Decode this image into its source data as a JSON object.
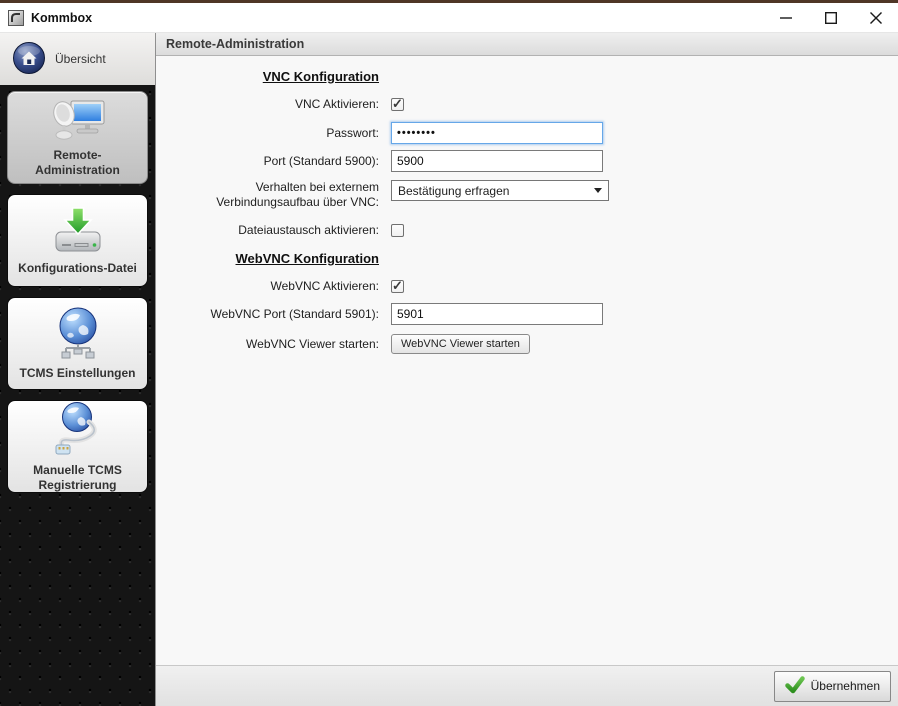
{
  "window": {
    "title": "Kommbox"
  },
  "sidebar": {
    "overview_label": "Übersicht",
    "items": [
      {
        "label": "Remote-Administration",
        "active": true
      },
      {
        "label": "Konfigurations-Datei",
        "active": false
      },
      {
        "label": "TCMS Einstellungen",
        "active": false
      },
      {
        "label": "Manuelle TCMS Registrierung",
        "active": false
      }
    ]
  },
  "header": {
    "title": "Remote-Administration"
  },
  "form": {
    "vnc": {
      "heading": "VNC Konfiguration",
      "enable_label": "VNC Aktivieren:",
      "enable_checked": true,
      "password_label": "Passwort:",
      "password_value": "••••••••",
      "port_label": "Port (Standard 5900):",
      "port_value": "5900",
      "behavior_label": "Verhalten bei externem Verbindungsaufbau über VNC:",
      "behavior_value": "Bestätigung erfragen",
      "file_exchange_label": "Dateiaustausch aktivieren:",
      "file_exchange_checked": false
    },
    "webvnc": {
      "heading": "WebVNC Konfiguration",
      "enable_label": "WebVNC Aktivieren:",
      "enable_checked": true,
      "port_label": "WebVNC Port (Standard 5901):",
      "port_value": "5901",
      "viewer_label": "WebVNC Viewer starten:",
      "viewer_button": "WebVNC Viewer starten"
    }
  },
  "footer": {
    "apply_label": "Übernehmen"
  },
  "colors": {
    "top_strip": "#4f3626",
    "focus_border": "#66a7e8",
    "apply_check_green": "#3e9e2e",
    "sidebar_bg": "#151515"
  }
}
